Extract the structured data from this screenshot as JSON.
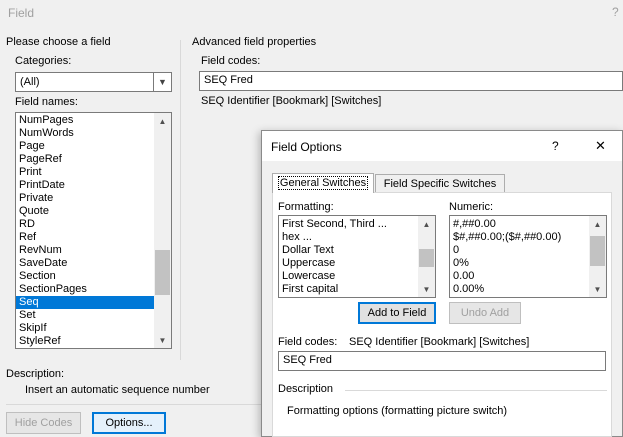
{
  "window": {
    "title": "Field",
    "help": "?"
  },
  "left_panel": {
    "group_title": "Please choose a field",
    "categories_label": "Categories:",
    "categories_value": "(All)",
    "field_names_label": "Field names:",
    "field_names": [
      "NumPages",
      "NumWords",
      "Page",
      "PageRef",
      "Print",
      "PrintDate",
      "Private",
      "Quote",
      "RD",
      "Ref",
      "RevNum",
      "SaveDate",
      "Section",
      "SectionPages",
      "Seq",
      "Set",
      "SkipIf",
      "StyleRef"
    ],
    "selected_field": "Seq",
    "description_label": "Description:",
    "description_text": "Insert an automatic sequence number"
  },
  "advanced": {
    "group_title": "Advanced field properties",
    "field_codes_label": "Field codes:",
    "field_codes_value": "SEQ Fred",
    "syntax": "SEQ Identifier [Bookmark] [Switches]"
  },
  "buttons": {
    "hide_codes": "Hide Codes",
    "options": "Options..."
  },
  "field_options": {
    "title": "Field Options",
    "help": "?",
    "close": "✕",
    "tabs": [
      "General Switches",
      "Field Specific Switches"
    ],
    "formatting_label": "Formatting:",
    "formatting_items": [
      "First Second, Third ...",
      "hex ...",
      "Dollar Text",
      "Uppercase",
      "Lowercase",
      "First capital"
    ],
    "numeric_label": "Numeric:",
    "numeric_items": [
      "#,##0.00",
      "$#,##0.00;($#,##0.00)",
      "0",
      "0%",
      "0.00",
      "0.00%"
    ],
    "add_to_field": "Add to Field",
    "undo_add": "Undo Add",
    "field_codes_label": "Field codes:",
    "field_codes_syntax": "SEQ Identifier [Bookmark] [Switches]",
    "field_codes_value": "SEQ Fred",
    "description_label": "Description",
    "description_text": "Formatting options (formatting picture switch)"
  },
  "colors": {
    "accent": "#0078d7",
    "selection": "#0078d7",
    "disabled_text": "#a0a0a0"
  }
}
